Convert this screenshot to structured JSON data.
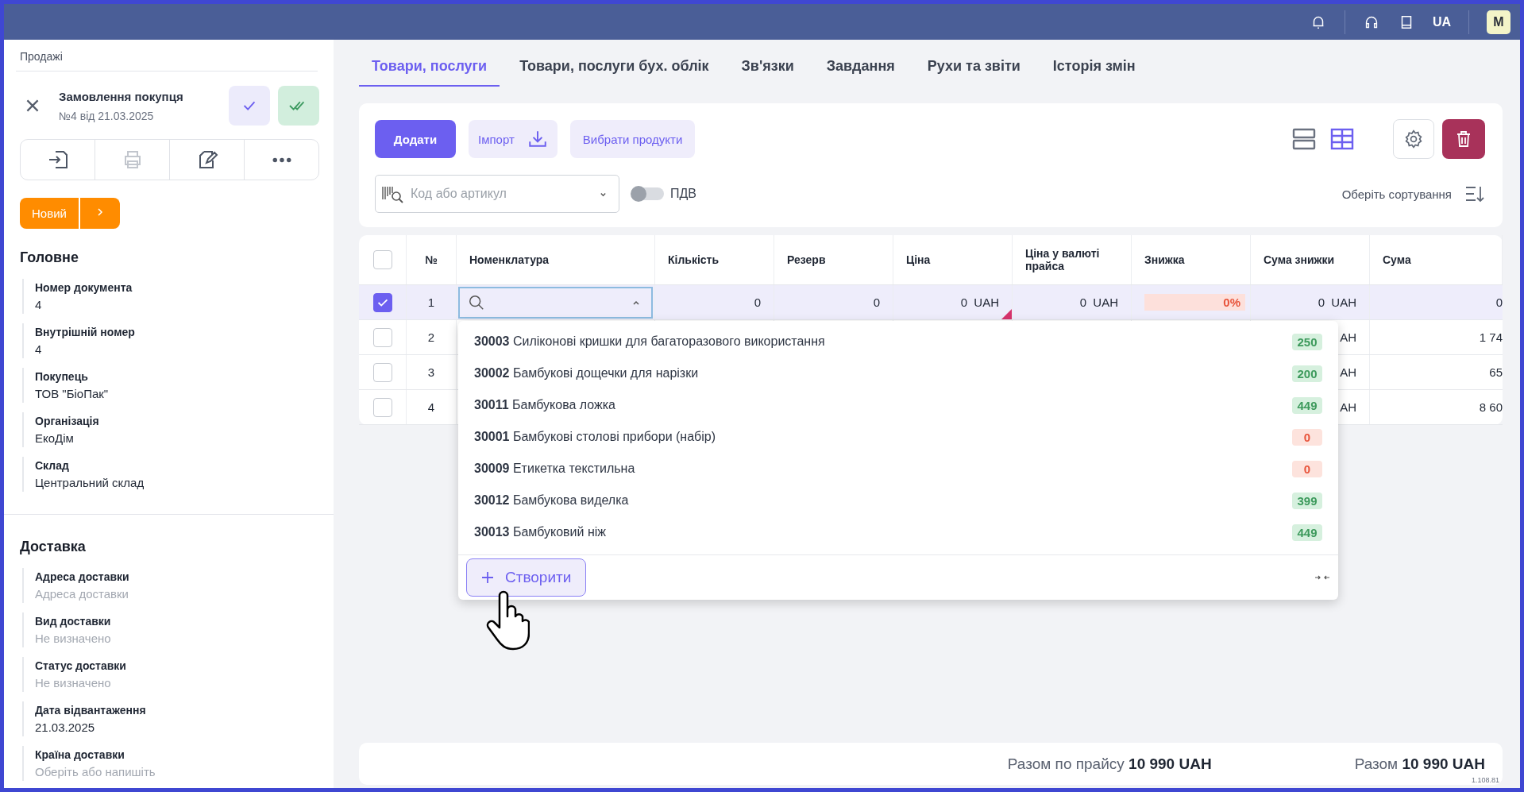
{
  "topbar": {
    "language": "UA",
    "avatar": "M"
  },
  "sidebar": {
    "breadcrumb": "Продажі",
    "document": {
      "title": "Замовлення покупця",
      "subtitle": "№4 від 21.03.2025"
    },
    "actions": [
      {
        "kind": "import",
        "disabled": false
      },
      {
        "kind": "print",
        "disabled": true
      },
      {
        "kind": "edit",
        "disabled": false
      },
      {
        "kind": "more",
        "disabled": false
      }
    ],
    "status": "Новий",
    "sections": [
      {
        "title": "Головне",
        "fields": [
          {
            "label": "Номер документа",
            "value": "4"
          },
          {
            "label": "Внутрішній номер",
            "value": "4"
          },
          {
            "label": "Покупець",
            "value": "ТОВ \"БіоПак\""
          },
          {
            "label": "Організація",
            "value": "ЕкоДім"
          },
          {
            "label": "Склад",
            "value": "Центральний склад"
          }
        ]
      },
      {
        "title": "Доставка",
        "fields": [
          {
            "label": "Адреса доставки",
            "placeholder": "Адреса доставки"
          },
          {
            "label": "Вид доставки",
            "placeholder": "Не визначено"
          },
          {
            "label": "Статус доставки",
            "placeholder": "Не визначено"
          },
          {
            "label": "Дата відвантаження",
            "value": "21.03.2025"
          },
          {
            "label": "Країна доставки",
            "placeholder": "Оберіть або напишіть"
          }
        ]
      }
    ]
  },
  "tabs": [
    {
      "label": "Товари, послуги",
      "selected": true
    },
    {
      "label": "Товари, послуги бух. облік",
      "selected": false
    },
    {
      "label": "Зв'язки",
      "selected": false
    },
    {
      "label": "Завдання",
      "selected": false
    },
    {
      "label": "Рухи та звіти",
      "selected": false
    },
    {
      "label": "Історія змін",
      "selected": false
    }
  ],
  "toolbar": {
    "add": "Додати",
    "import": "Імпорт",
    "choose": "Вибрати продукти",
    "search": {
      "placeholder": "Код або артикул"
    },
    "vat": {
      "label": "ПДВ",
      "on": false
    },
    "views": [
      {
        "kind": "rows",
        "selected": false
      },
      {
        "kind": "grid",
        "selected": true
      }
    ],
    "sort": "Оберіть сортування"
  },
  "table": {
    "all_selected": false,
    "columns": [
      "№",
      "Номенклатура",
      "Кількість",
      "Резерв",
      "Ціна",
      "Ціна у валюті прайса",
      "Знижка",
      "Сума знижки",
      "Сума"
    ],
    "rows": [
      {
        "number": "1",
        "selected": true,
        "quantity": "0",
        "reserve": "0",
        "price": "0  UAH",
        "price_flag": true,
        "price_currency": "0  UAH",
        "discount": "0%",
        "discount_sum": "0  UAH",
        "sum": "0"
      },
      {
        "number": "2",
        "selected": false,
        "discount_sum": "АН",
        "sum": "1 74"
      },
      {
        "number": "3",
        "selected": false,
        "discount_sum": "АН",
        "sum": "65"
      },
      {
        "number": "4",
        "selected": false,
        "discount_sum": "АН",
        "sum": "8 60"
      }
    ]
  },
  "dropdown": {
    "items": [
      {
        "code": "30003",
        "name": "Силіконові кришки для багаторазового використання",
        "stock": "250",
        "available": true
      },
      {
        "code": "30002",
        "name": "Бамбукові дощечки для нарізки",
        "stock": "200",
        "available": true
      },
      {
        "code": "30011",
        "name": "Бамбукова ложка",
        "stock": "449",
        "available": true
      },
      {
        "code": "30001",
        "name": "Бамбукові столові прибори (набір)",
        "stock": "0",
        "available": false
      },
      {
        "code": "30009",
        "name": "Етикетка текстильна",
        "stock": "0",
        "available": false
      },
      {
        "code": "30012",
        "name": "Бамбукова виделка",
        "stock": "399",
        "available": true
      },
      {
        "code": "30013",
        "name": "Бамбуковий ніж",
        "stock": "449",
        "available": true
      }
    ],
    "create": "Створити"
  },
  "footer": {
    "price_total_label": "Разом по прайсу",
    "price_total": "10 990 UAH",
    "total_label": "Разом",
    "total": "10 990 UAH",
    "version": "1.108.81"
  }
}
